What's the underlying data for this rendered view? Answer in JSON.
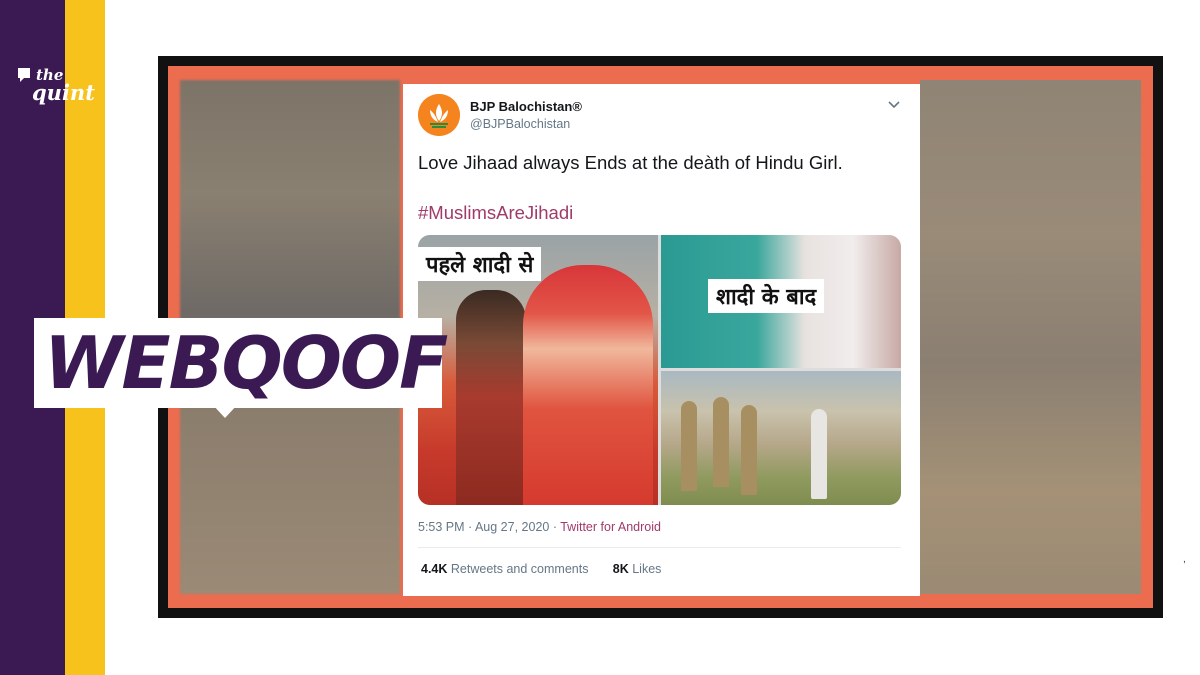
{
  "brand": {
    "logo_the": "the",
    "logo_quint": "quint",
    "purple": "#3b1a54",
    "yellow": "#f8c21c"
  },
  "label": {
    "text": "WEBQOOF"
  },
  "tweet": {
    "display_name": "BJP Balochistan®",
    "handle": "@BJPBalochistan",
    "text": "Love Jihaad always Ends at the deàth of Hindu Girl.",
    "hashtag": "#MuslimsAreJihadi",
    "media_captions": [
      "पहले शादी से",
      "शादी के बाद"
    ],
    "time": "5:53 PM · Aug 27, 2020 · ",
    "source": "Twitter for Android",
    "retweets_count": "4.4K",
    "retweets_label": "Retweets and comments",
    "likes_count": "8K",
    "likes_label": "Likes",
    "avatar_icon": "bjp-lotus-icon",
    "menu_icon": "chevron-down-icon"
  },
  "colors": {
    "frame_accent": "#ec6c4f",
    "link": "#a03a6a"
  }
}
